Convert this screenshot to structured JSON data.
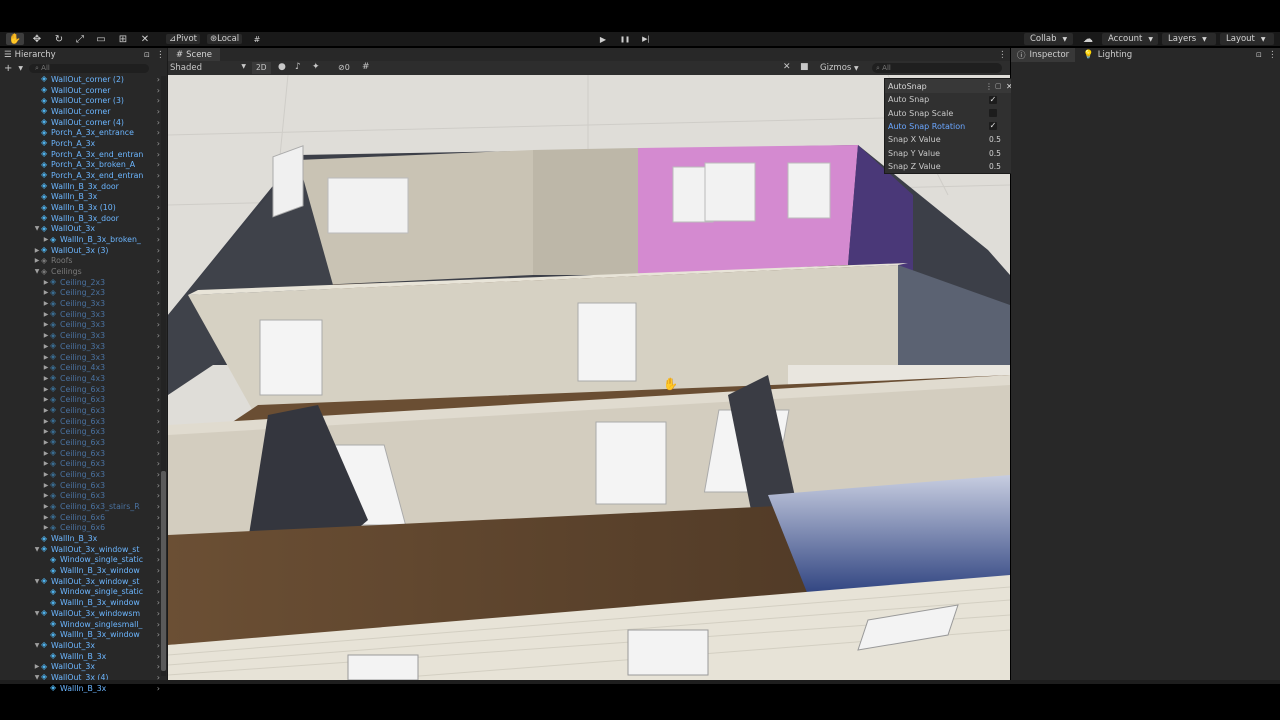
{
  "toolbar": {
    "pivot_label": "Pivot",
    "local_label": "Local",
    "collab_label": "Collab",
    "account_label": "Account",
    "layers_label": "Layers",
    "layout_label": "Layout"
  },
  "hierarchy": {
    "tab_label": "Hierarchy",
    "search_placeholder": "All",
    "rows": [
      {
        "label": "WallOut_corner (2)",
        "indent": 1,
        "style": "normal",
        "arrow": ""
      },
      {
        "label": "WallOut_corner",
        "indent": 1,
        "style": "normal",
        "arrow": ""
      },
      {
        "label": "WallOut_corner (3)",
        "indent": 1,
        "style": "normal",
        "arrow": ""
      },
      {
        "label": "WallOut_corner",
        "indent": 1,
        "style": "normal",
        "arrow": ""
      },
      {
        "label": "WallOut_corner (4)",
        "indent": 1,
        "style": "normal",
        "arrow": ""
      },
      {
        "label": "Porch_A_3x_entrance",
        "indent": 1,
        "style": "normal",
        "arrow": ""
      },
      {
        "label": "Porch_A_3x",
        "indent": 1,
        "style": "normal",
        "arrow": ""
      },
      {
        "label": "Porch_A_3x_end_entran",
        "indent": 1,
        "style": "normal",
        "arrow": ""
      },
      {
        "label": "Porch_A_3x_broken_A",
        "indent": 1,
        "style": "normal",
        "arrow": ""
      },
      {
        "label": "Porch_A_3x_end_entran",
        "indent": 1,
        "style": "normal",
        "arrow": ""
      },
      {
        "label": "WallIn_B_3x_door",
        "indent": 1,
        "style": "normal",
        "arrow": ""
      },
      {
        "label": "WallIn_B_3x",
        "indent": 1,
        "style": "normal",
        "arrow": ""
      },
      {
        "label": "WallIn_B_3x (10)",
        "indent": 1,
        "style": "normal",
        "arrow": ""
      },
      {
        "label": "WallIn_B_3x_door",
        "indent": 1,
        "style": "normal",
        "arrow": ""
      },
      {
        "label": "WallOut_3x",
        "indent": 1,
        "style": "normal",
        "arrow": "▼"
      },
      {
        "label": "WallIn_B_3x_broken_",
        "indent": 2,
        "style": "normal",
        "arrow": "▶"
      },
      {
        "label": "WallOut_3x (3)",
        "indent": 1,
        "style": "normal",
        "arrow": "▶"
      },
      {
        "label": "Roofs",
        "indent": 1,
        "style": "grey",
        "arrow": "▶"
      },
      {
        "label": "Ceilings",
        "indent": 1,
        "style": "grey",
        "arrow": "▼"
      },
      {
        "label": "Ceiling_2x3",
        "indent": 2,
        "style": "dim",
        "arrow": "▶"
      },
      {
        "label": "Ceiling_2x3",
        "indent": 2,
        "style": "dim",
        "arrow": "▶"
      },
      {
        "label": "Ceiling_3x3",
        "indent": 2,
        "style": "dim",
        "arrow": "▶"
      },
      {
        "label": "Ceiling_3x3",
        "indent": 2,
        "style": "dim",
        "arrow": "▶"
      },
      {
        "label": "Ceiling_3x3",
        "indent": 2,
        "style": "dim",
        "arrow": "▶"
      },
      {
        "label": "Ceiling_3x3",
        "indent": 2,
        "style": "dim",
        "arrow": "▶"
      },
      {
        "label": "Ceiling_3x3",
        "indent": 2,
        "style": "dim",
        "arrow": "▶"
      },
      {
        "label": "Ceiling_3x3",
        "indent": 2,
        "style": "dim",
        "arrow": "▶"
      },
      {
        "label": "Ceiling_4x3",
        "indent": 2,
        "style": "dim",
        "arrow": "▶"
      },
      {
        "label": "Ceiling_4x3",
        "indent": 2,
        "style": "dim",
        "arrow": "▶"
      },
      {
        "label": "Ceiling_6x3",
        "indent": 2,
        "style": "dim",
        "arrow": "▶"
      },
      {
        "label": "Ceiling_6x3",
        "indent": 2,
        "style": "dim",
        "arrow": "▶"
      },
      {
        "label": "Ceiling_6x3",
        "indent": 2,
        "style": "dim",
        "arrow": "▶"
      },
      {
        "label": "Ceiling_6x3",
        "indent": 2,
        "style": "dim",
        "arrow": "▶"
      },
      {
        "label": "Ceiling_6x3",
        "indent": 2,
        "style": "dim",
        "arrow": "▶"
      },
      {
        "label": "Ceiling_6x3",
        "indent": 2,
        "style": "dim",
        "arrow": "▶"
      },
      {
        "label": "Ceiling_6x3",
        "indent": 2,
        "style": "dim",
        "arrow": "▶"
      },
      {
        "label": "Ceiling_6x3",
        "indent": 2,
        "style": "dim",
        "arrow": "▶"
      },
      {
        "label": "Ceiling_6x3",
        "indent": 2,
        "style": "dim",
        "arrow": "▶"
      },
      {
        "label": "Ceiling_6x3",
        "indent": 2,
        "style": "dim",
        "arrow": "▶"
      },
      {
        "label": "Ceiling_6x3",
        "indent": 2,
        "style": "dim",
        "arrow": "▶"
      },
      {
        "label": "Ceiling_6x3_stairs_R",
        "indent": 2,
        "style": "dim",
        "arrow": "▶"
      },
      {
        "label": "Ceiling_6x6",
        "indent": 2,
        "style": "dim",
        "arrow": "▶"
      },
      {
        "label": "Ceiling_6x6",
        "indent": 2,
        "style": "dim",
        "arrow": "▶"
      },
      {
        "label": "WallIn_B_3x",
        "indent": 1,
        "style": "normal",
        "arrow": ""
      },
      {
        "label": "WallOut_3x_window_st",
        "indent": 1,
        "style": "normal",
        "arrow": "▼"
      },
      {
        "label": "Window_single_static",
        "indent": 2,
        "style": "normal",
        "arrow": ""
      },
      {
        "label": "WallIn_B_3x_window",
        "indent": 2,
        "style": "normal",
        "arrow": ""
      },
      {
        "label": "WallOut_3x_window_st",
        "indent": 1,
        "style": "normal",
        "arrow": "▼"
      },
      {
        "label": "Window_single_static",
        "indent": 2,
        "style": "normal",
        "arrow": ""
      },
      {
        "label": "WallIn_B_3x_window",
        "indent": 2,
        "style": "normal",
        "arrow": ""
      },
      {
        "label": "WallOut_3x_windowsm",
        "indent": 1,
        "style": "normal",
        "arrow": "▼"
      },
      {
        "label": "Window_singlesmall_",
        "indent": 2,
        "style": "normal",
        "arrow": ""
      },
      {
        "label": "WallIn_B_3x_window",
        "indent": 2,
        "style": "normal",
        "arrow": ""
      },
      {
        "label": "WallOut_3x",
        "indent": 1,
        "style": "normal",
        "arrow": "▼"
      },
      {
        "label": "WallIn_B_3x",
        "indent": 2,
        "style": "normal",
        "arrow": ""
      },
      {
        "label": "WallOut_3x",
        "indent": 1,
        "style": "normal",
        "arrow": "▶"
      },
      {
        "label": "WallOut_3x (4)",
        "indent": 1,
        "style": "normal",
        "arrow": "▼"
      },
      {
        "label": "WallIn_B_3x",
        "indent": 2,
        "style": "normal",
        "arrow": ""
      }
    ]
  },
  "scene": {
    "tab_label": "Scene",
    "shading_mode": "Shaded",
    "mode_2d": "2D",
    "hidden_count": "0",
    "gizmos_label": "Gizmos",
    "search_placeholder": "All"
  },
  "autosnap": {
    "title": "AutoSnap",
    "auto_snap_label": "Auto Snap",
    "auto_snap_scale_label": "Auto Snap Scale",
    "auto_snap_rotation_label": "Auto Snap Rotation",
    "snap_x_label": "Snap X Value",
    "snap_x_value": "0.5",
    "snap_y_label": "Snap Y Value",
    "snap_y_value": "0.5",
    "snap_z_label": "Snap Z Value",
    "snap_z_value": "0.5",
    "check_mark": "✓"
  },
  "inspector": {
    "inspector_tab": "Inspector",
    "lighting_tab": "Lighting"
  },
  "icons": {
    "hand": "✋",
    "move": "✥",
    "rotate": "↻",
    "scale": "⤢",
    "rect": "▭",
    "transform": "⊞",
    "custom": "✕",
    "play": "▶",
    "pause": "❚❚",
    "step": "▶|",
    "add": "+",
    "search": "⌕",
    "kebab": "⋮",
    "lock": "🔒",
    "cloud": "☁"
  },
  "colors": {
    "accent_blue": "#6cb6ff",
    "panel_bg": "#282828"
  }
}
